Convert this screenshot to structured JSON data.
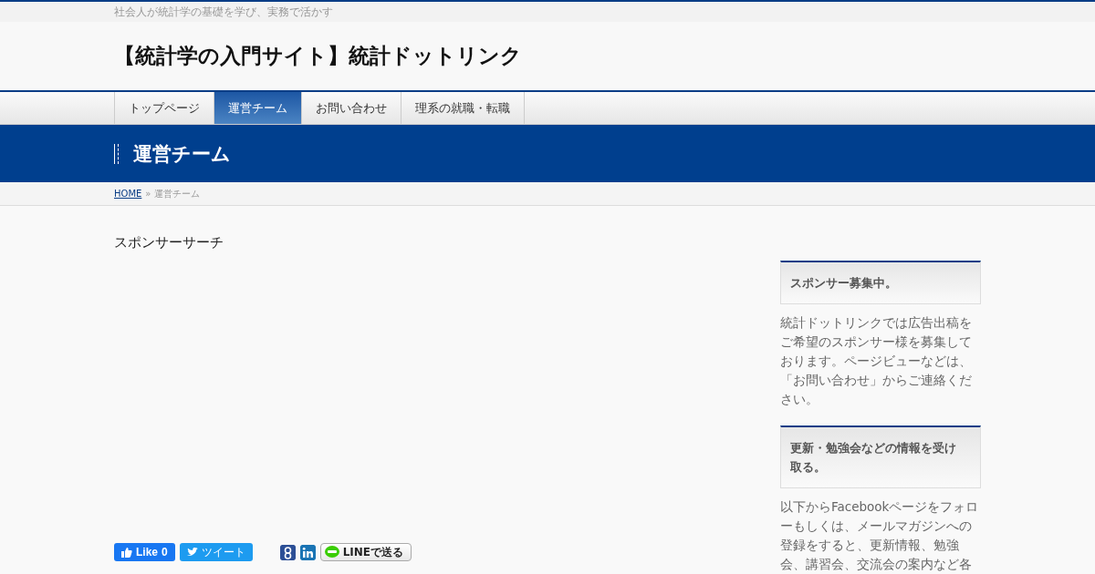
{
  "tagline": "社会人が統計学の基礎を学び、実務で活かす",
  "site_title": "【統計学の入門サイト】統計ドットリンク",
  "nav": [
    {
      "label": "トップページ",
      "selected": false
    },
    {
      "label": "運営チーム",
      "selected": true
    },
    {
      "label": "お問い合わせ",
      "selected": false
    },
    {
      "label": "理系の就職・転職",
      "selected": false
    }
  ],
  "page_title": "運営チーム",
  "breadcrumb": {
    "home": "HOME",
    "separator": "»",
    "current": "運営チーム"
  },
  "content": {
    "text": "スポンサーサーチ"
  },
  "share": {
    "like": "Like",
    "like_count": "0",
    "tweet": "ツイート",
    "line": "LINEで送る"
  },
  "sidebar": [
    {
      "heading": "スポンサー募集中。",
      "body": "統計ドットリンクでは広告出稿をご希望のスポンサー様を募集しております。ページビューなどは、「お問い合わせ」からご連絡ください。"
    },
    {
      "heading": "更新・勉強会などの情報を受け取る。",
      "body": "以下からFacebookページをフォローもしくは、メールマガジンへの登録をすると、更新情報、勉強会、講習会、交流会の案内など各"
    }
  ]
}
